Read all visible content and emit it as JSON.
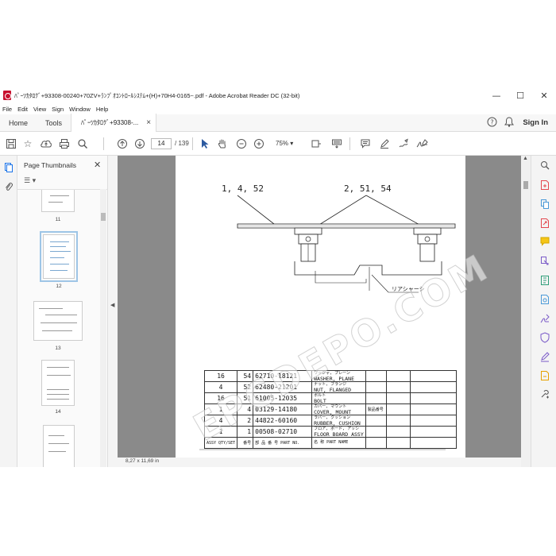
{
  "window": {
    "title": "ﾊﾟｰﾂｶﾀﾛｸﾞ+93308-00240+70ZV+ﾗﾝﾌﾟｵｺﾝﾄﾛｰﾙｼｽﾃﾑ+(H)+70H4-0165~.pdf - Adobe Acrobat Reader DC (32-bit)",
    "minimize": "—",
    "maximize": "☐",
    "close": "✕"
  },
  "menu": [
    "File",
    "Edit",
    "View",
    "Sign",
    "Window",
    "Help"
  ],
  "tabs": {
    "home": "Home",
    "tools": "Tools",
    "document": "ﾊﾟｰﾂｶﾀﾛｸﾞ+93308-...",
    "close": "×",
    "help": "?",
    "bell": "🔔",
    "signin": "Sign In"
  },
  "toolbar": {
    "page_current": "14",
    "page_total": "/ 139",
    "zoom": "75%"
  },
  "panel": {
    "title": "Page Thumbnails",
    "close": "✕",
    "options": "☰ ▾",
    "thumbnails": [
      {
        "label": "11",
        "selected": false
      },
      {
        "label": "12",
        "selected": true
      },
      {
        "label": "13",
        "selected": false
      },
      {
        "label": "14",
        "selected": false
      },
      {
        "label": "15",
        "selected": false
      }
    ]
  },
  "status": {
    "page_size": "8,27 x 11,69 in"
  },
  "watermark": "EPCDEPO.COM",
  "drawing": {
    "callout_left": "1, 4, 52",
    "callout_right": "2, 51, 54",
    "rear_chassis_label": "リアシャーシ",
    "parts": [
      {
        "set": "16",
        "ref": "54",
        "part_no": "62710-18121",
        "name_jp": "ワッシャ, プレーン",
        "name": "WASHER, PLANE",
        "remark": ""
      },
      {
        "set": "4",
        "ref": "52",
        "part_no": "62480-21201",
        "name_jp": "ナット, フランジ",
        "name": "NUT, FLANGED",
        "remark": ""
      },
      {
        "set": "16",
        "ref": "51",
        "part_no": "61005-12035",
        "name_jp": "ボルト",
        "name": "BOLT",
        "remark": ""
      },
      {
        "set": "1",
        "ref": "4",
        "part_no": "03129-14180",
        "name_jp": "カバー, マウント",
        "name": "COVER, MOUNT",
        "remark": "製品番号"
      },
      {
        "set": "4",
        "ref": "2",
        "part_no": "44822-60160",
        "name_jp": "ラバー, クッション",
        "name": "RUBBER, CUSHION",
        "remark": ""
      },
      {
        "set": "1",
        "ref": "1",
        "part_no": "00508-02710",
        "name_jp": "フロア, ボード, アッシ",
        "name": "FLOOR BOARD ASSY",
        "remark": ""
      }
    ],
    "header": {
      "qty": "ASSY QTY/SET",
      "ref": "番号",
      "part_no_jp": "部 品 番 号",
      "part_no": "PART NO.",
      "name_jp": "名 称",
      "name": "PART NAME"
    }
  }
}
